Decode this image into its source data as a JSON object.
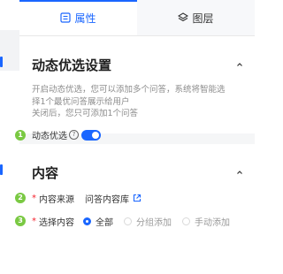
{
  "tabs": [
    {
      "label": "属性",
      "icon": "attribute-icon",
      "active": true
    },
    {
      "label": "图层",
      "icon": "layers-icon",
      "active": false
    }
  ],
  "dynamic_section": {
    "title": "动态优选设置",
    "description_line1": "开启动态优选，您可以添加多个问答，系统将智能选",
    "description_line2": "择1个最优问答展示给用户",
    "description_line3": "关闭后，您只可添加1个问答",
    "toggle_label": "动态优选",
    "toggle_on": true,
    "marker": "1"
  },
  "content_section": {
    "title": "内容",
    "source_label": "内容来源",
    "source_value": "问答内容库",
    "source_marker": "2",
    "select_label": "选择内容",
    "select_marker": "3",
    "options": [
      {
        "label": "全部",
        "checked": true
      },
      {
        "label": "分组添加",
        "checked": false
      },
      {
        "label": "手动添加",
        "checked": false
      }
    ]
  },
  "colors": {
    "accent": "#1a66ff",
    "marker": "#7ac943",
    "required": "#f5222d"
  }
}
